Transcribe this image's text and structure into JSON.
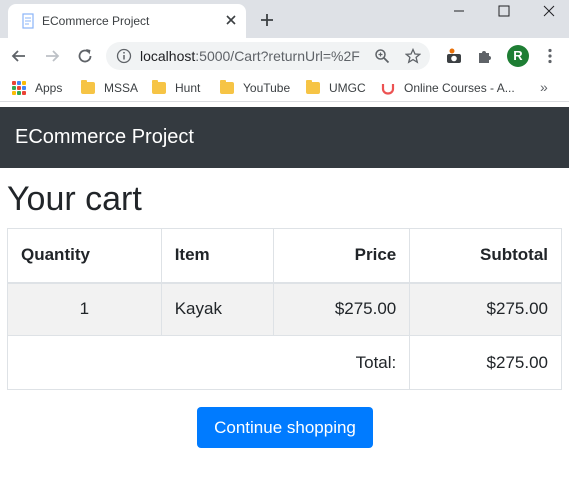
{
  "browser": {
    "tab_title": "ECommerce Project",
    "address": "localhost:5000/Cart?returnUrl=%2F",
    "address_host": "localhost",
    "address_rest": ":5000/Cart?returnUrl=%2F",
    "profile_initial": "R",
    "bookmarks": [
      "Apps",
      "MSSA",
      "Hunt",
      "YouTube",
      "UMGC",
      "Online Courses - A..."
    ],
    "more_bookmarks": "»"
  },
  "navbar": {
    "brand": "ECommerce Project"
  },
  "page": {
    "title": "Your cart"
  },
  "cart": {
    "headers": {
      "quantity": "Quantity",
      "item": "Item",
      "price": "Price",
      "subtotal": "Subtotal"
    },
    "rows": [
      {
        "quantity": "1",
        "item": "Kayak",
        "price": "$275.00",
        "subtotal": "$275.00"
      }
    ],
    "total_label": "Total:",
    "total_value": "$275.00"
  },
  "actions": {
    "continue_label": "Continue shopping"
  },
  "colors": {
    "navbar": "#343a40",
    "primary": "#007bff",
    "stripe": "#f2f2f2",
    "avatar": "#1e7e34"
  }
}
